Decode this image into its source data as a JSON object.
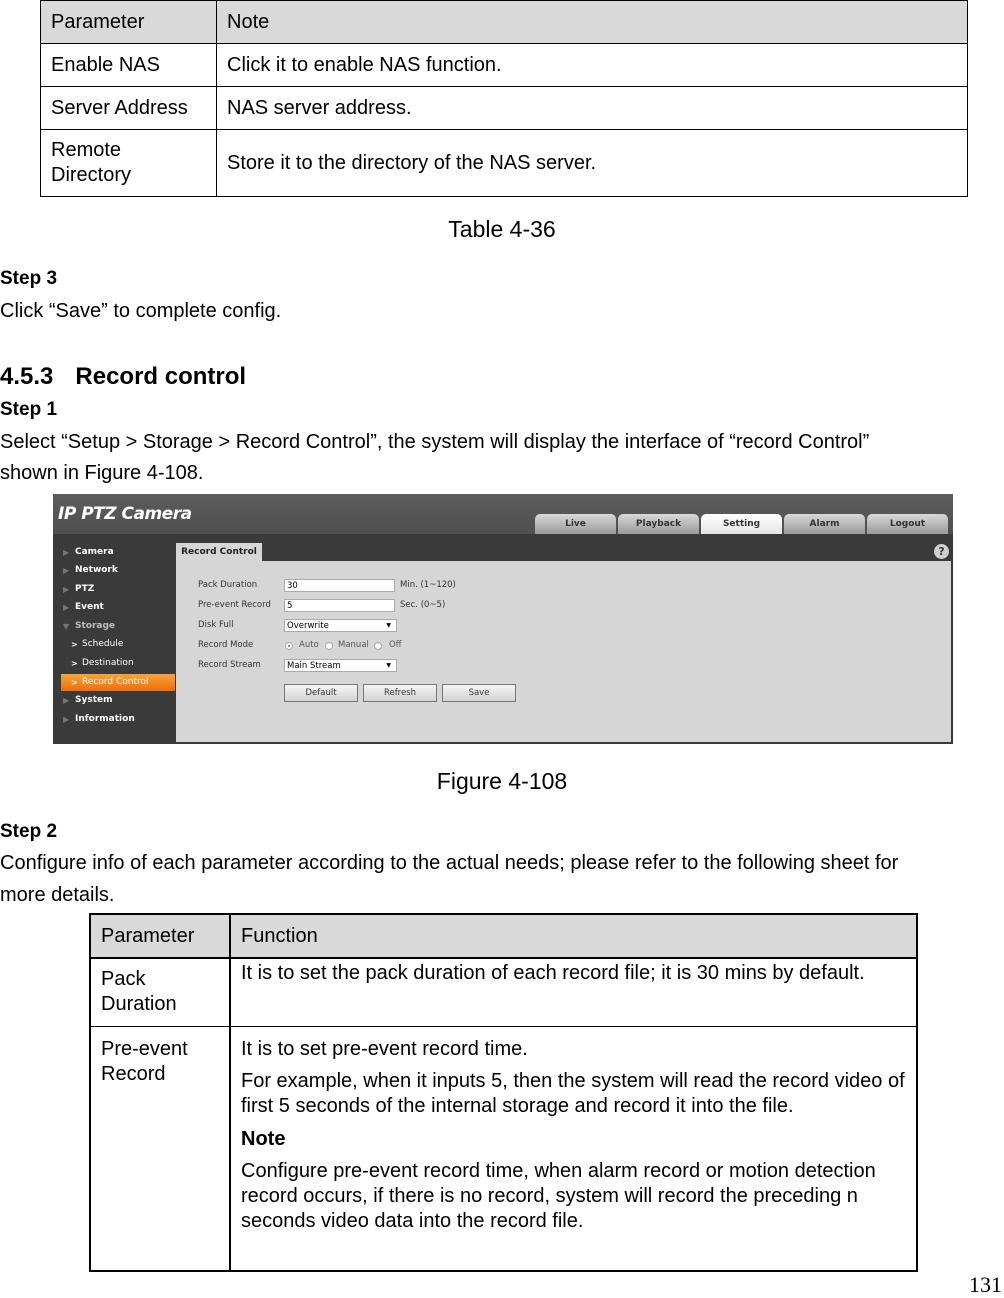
{
  "nas_table": {
    "headers": [
      "Parameter",
      "Note"
    ],
    "rows": [
      [
        "Enable NAS",
        "Click it to enable NAS function."
      ],
      [
        "Server Address",
        "NAS server address."
      ],
      [
        "Remote Directory",
        "Store it to the directory of the NAS server."
      ]
    ],
    "caption": "Table 4-36"
  },
  "step3": {
    "heading": "Step 3",
    "text": "Click “Save” to complete config."
  },
  "section": {
    "number": "4.5.3",
    "title": "Record control"
  },
  "step1": {
    "heading": "Step 1",
    "line1": "Select “Setup > Storage > Record Control”, the system will display the interface of “record Control”",
    "line2": "shown in Figure 4-108."
  },
  "figure": {
    "caption": "Figure 4-108",
    "app_title": "IP PTZ Camera",
    "nav_tabs": [
      {
        "label": "Live",
        "active": false
      },
      {
        "label": "Playback",
        "active": false
      },
      {
        "label": "Setting",
        "active": true
      },
      {
        "label": "Alarm",
        "active": false
      },
      {
        "label": "Logout",
        "active": false
      }
    ],
    "sidebar": [
      {
        "label": "Camera"
      },
      {
        "label": "Network"
      },
      {
        "label": "PTZ"
      },
      {
        "label": "Event"
      },
      {
        "label": "Storage"
      },
      {
        "label": "Schedule"
      },
      {
        "label": "Destination"
      },
      {
        "label": "Record Control"
      },
      {
        "label": "System"
      },
      {
        "label": "Information"
      }
    ],
    "sub_tab": "Record Control",
    "help_icon": "?",
    "form": {
      "pack_duration": {
        "label": "Pack Duration",
        "value": "30",
        "hint": "Min. (1~120)"
      },
      "pre_event": {
        "label": "Pre-event Record",
        "value": "5",
        "hint": "Sec. (0~5)"
      },
      "disk_full": {
        "label": "Disk Full",
        "value": "Overwrite"
      },
      "record_mode": {
        "label": "Record Mode",
        "options": [
          "Auto",
          "Manual",
          "Off"
        ],
        "selected": "Auto"
      },
      "record_stream": {
        "label": "Record Stream",
        "value": "Main Stream"
      }
    },
    "buttons": {
      "default": "Default",
      "refresh": "Refresh",
      "save": "Save"
    },
    "dropdown_arrow": "▼"
  },
  "step2": {
    "heading": "Step 2",
    "line1": "Configure info of each parameter according to the actual needs; please refer to the following sheet for",
    "line2": "more details."
  },
  "func_table": {
    "headers": [
      "Parameter",
      "Function"
    ],
    "rows": [
      {
        "param": "Pack Duration",
        "lines": [
          "It is to set the pack duration of each record file; it is 30 mins by default."
        ]
      },
      {
        "param": "Pre-event Record",
        "p1": "It is to set pre-event record time.",
        "p2": "For example, when it inputs 5, then the system will read the record video of first 5 seconds of the internal storage and record it into the file.",
        "note": "Note",
        "p3": "Configure pre-event record time, when alarm record or motion detection record occurs, if there is no record, system will record the preceding n seconds video data into the record file."
      }
    ]
  },
  "page_number": "131"
}
